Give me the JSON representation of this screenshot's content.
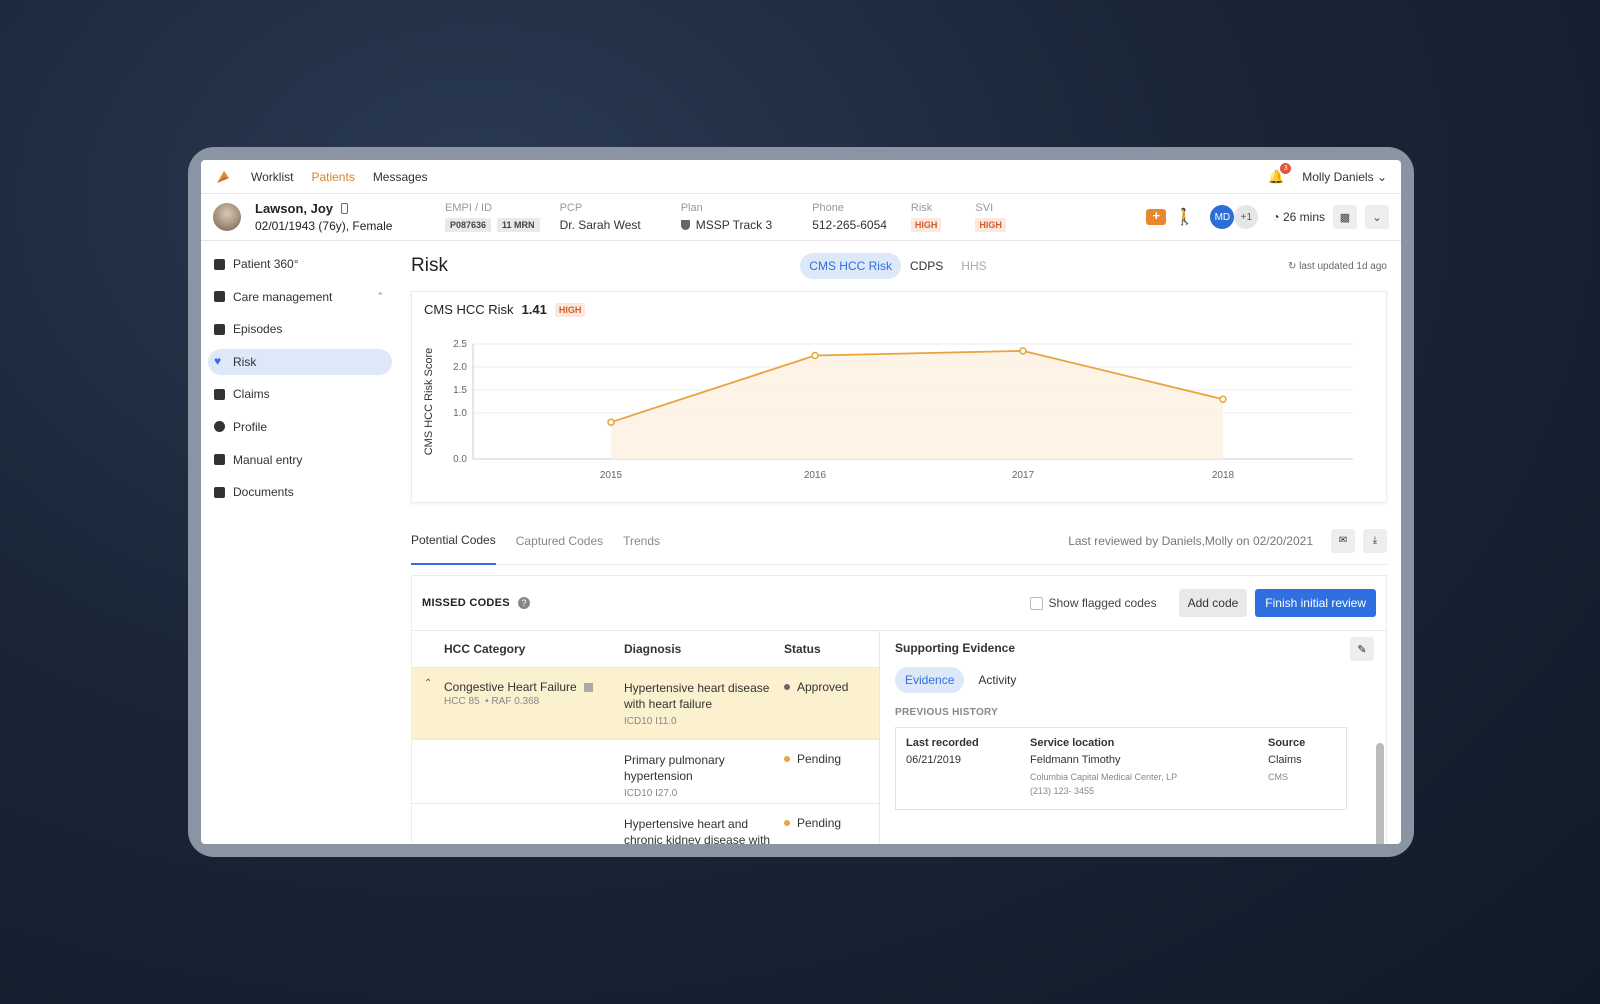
{
  "nav": {
    "links": [
      "Worklist",
      "Patients",
      "Messages"
    ],
    "active": "Patients",
    "notif_count": "3",
    "user": "Molly Daniels"
  },
  "patient": {
    "name": "Lawson, Joy",
    "dob": "02/01/1943 (76y), Female",
    "empi_label": "EMPI / ID",
    "empi_id": "P087636",
    "mrn": "11 MRN",
    "pcp_label": "PCP",
    "pcp": "Dr. Sarah West",
    "plan_label": "Plan",
    "plan": "MSSP Track 3",
    "phone_label": "Phone",
    "phone": "512-265-6054",
    "risk_label": "Risk",
    "risk": "HIGH",
    "svi_label": "SVI",
    "svi": "HIGH",
    "avatar_initials": "MD",
    "avatar_more": "+1",
    "timer": "26 mins"
  },
  "sidebar": {
    "items": [
      {
        "label": "Patient 360°"
      },
      {
        "label": "Care management"
      },
      {
        "label": "Episodes"
      },
      {
        "label": "Risk"
      },
      {
        "label": "Claims"
      },
      {
        "label": "Profile"
      },
      {
        "label": "Manual entry"
      },
      {
        "label": "Documents"
      }
    ]
  },
  "risk": {
    "title": "Risk",
    "segments": [
      "CMS HCC Risk",
      "CDPS",
      "HHS"
    ],
    "updated": "last updated 1d ago",
    "chart_title": "CMS HCC Risk",
    "score": "1.41",
    "level": "HIGH"
  },
  "chart_data": {
    "type": "area",
    "x": [
      "2015",
      "2016",
      "2017",
      "2018"
    ],
    "series": [
      {
        "values": [
          0.8,
          2.25,
          2.35,
          1.3
        ]
      }
    ],
    "ylabel": "CMS HCC Risk Score",
    "yticks": [
      "0.0",
      "1.0",
      "1.5",
      "2.0",
      "2.5"
    ],
    "ylim": [
      0,
      2.5
    ],
    "grid": true,
    "color": "#e8a33d"
  },
  "tabs": {
    "items": [
      "Potential Codes",
      "Captured Codes",
      "Trends"
    ],
    "reviewed": "Last reviewed by Daniels,Molly on 02/20/2021"
  },
  "codes": {
    "title": "MISSED CODES",
    "flag_label": "Show flagged codes",
    "add_label": "Add code",
    "finish_label": "Finish initial review",
    "headers": [
      "HCC Category",
      "Diagnosis",
      "Status"
    ],
    "rows": [
      {
        "category": "Congestive Heart Failure",
        "hcc": "HCC 85",
        "raf": "RAF 0.368",
        "diagnosis": "Hypertensive heart disease with heart failure",
        "icd": "ICD10 I11.0",
        "status": "Approved"
      },
      {
        "category": "",
        "hcc": "",
        "raf": "",
        "diagnosis": "Primary pulmonary hypertension",
        "icd": "ICD10 I27.0",
        "status": "Pending"
      },
      {
        "category": "",
        "hcc": "",
        "raf": "",
        "diagnosis": "Hypertensive heart and chronic kidney disease with",
        "icd": "",
        "status": "Pending"
      }
    ]
  },
  "evidence": {
    "title": "Supporting Evidence",
    "tabs": [
      "Evidence",
      "Activity"
    ],
    "history_label": "PREVIOUS HISTORY",
    "last_recorded_label": "Last recorded",
    "last_recorded": "06/21/2019",
    "location_label": "Service location",
    "location": "Feldmann Timothy",
    "location_sub1": "Columbia Capital Medical Center, LP",
    "location_sub2": "(213) 123- 3455",
    "source_label": "Source",
    "source": "Claims",
    "source_sub": "CMS"
  }
}
